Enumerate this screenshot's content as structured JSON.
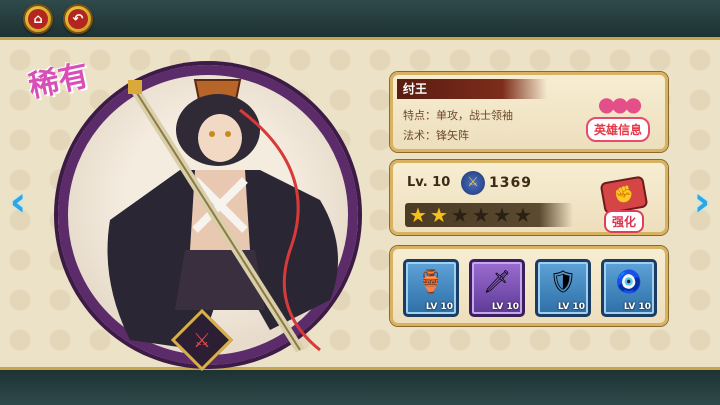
{
  "rarity": "稀有",
  "hero": {
    "name": "纣王",
    "trait_line": "特点：单攻，战士领袖",
    "formation_line": "法术：锋矢阵",
    "info_button": "英雄信息",
    "level": "Lv. 10",
    "power": "1369",
    "stars_filled": 2,
    "stars_total": 6,
    "enhance_button": "强化"
  },
  "equipment": [
    {
      "name": "gourd-icon",
      "level": "LV 10",
      "rarity": "blue"
    },
    {
      "name": "sword-icon",
      "level": "LV 10",
      "rarity": "purple"
    },
    {
      "name": "armor-icon",
      "level": "LV 10",
      "rarity": "blue"
    },
    {
      "name": "charm-icon",
      "level": "LV 10",
      "rarity": "blue"
    }
  ],
  "colors": {
    "frame": "#2f4a4b",
    "gold": "#d8b261",
    "rarity_text": "#d94fb8",
    "nav_arrow": "#2aa7e4"
  }
}
